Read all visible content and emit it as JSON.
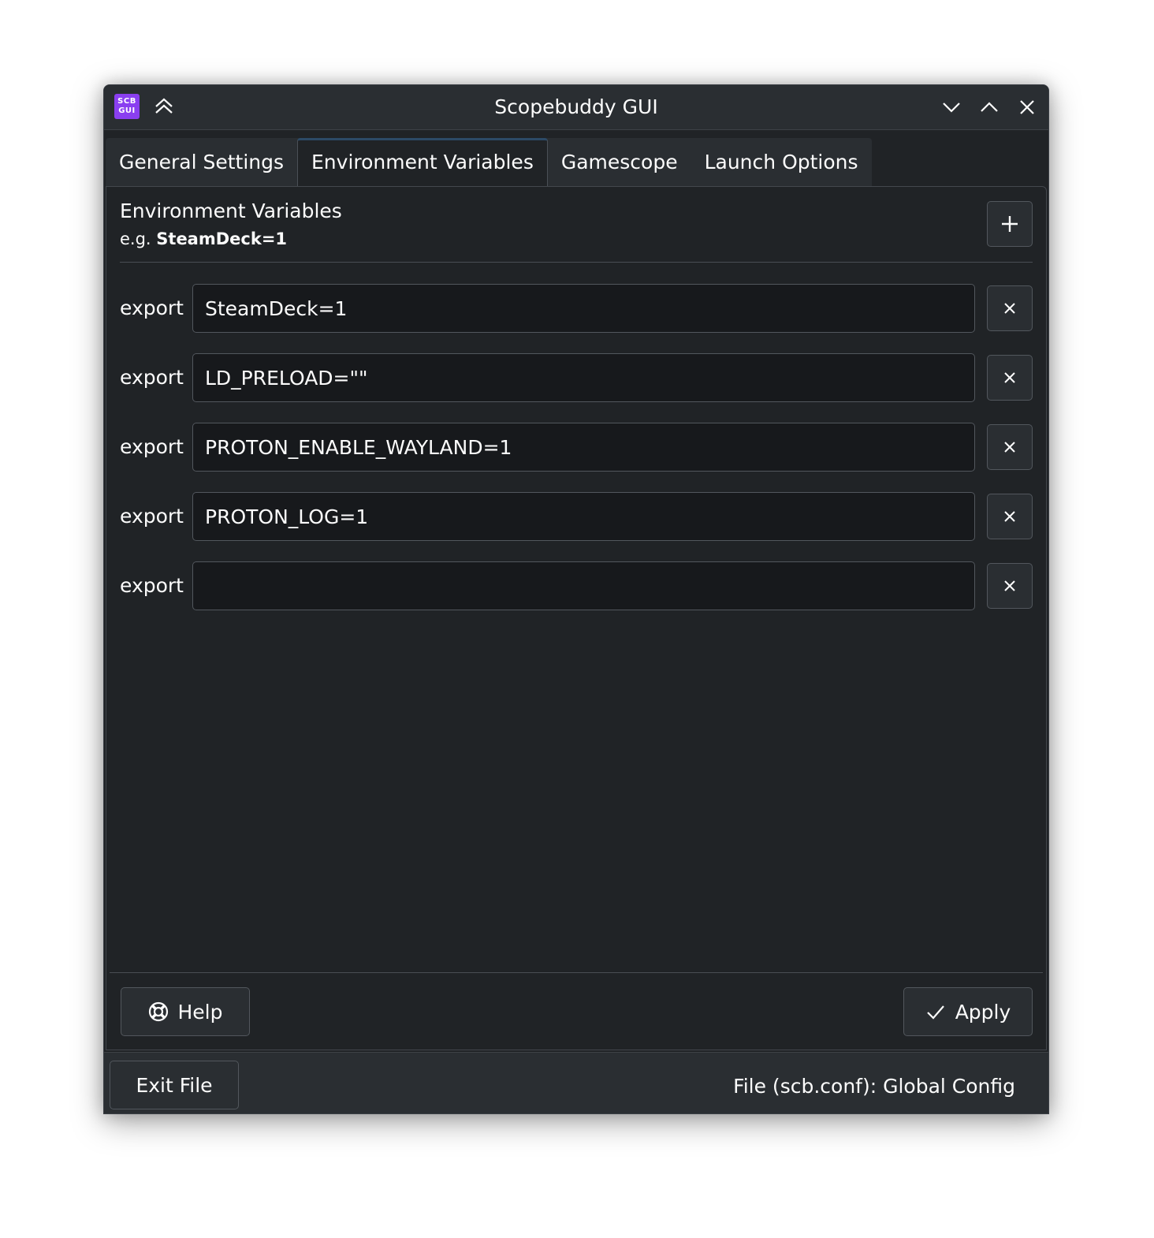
{
  "window": {
    "title": "Scopebuddy GUI",
    "app_icon_line1": "SCB",
    "app_icon_line2": "GUI"
  },
  "tabs": [
    {
      "label": "General Settings",
      "active": false
    },
    {
      "label": "Environment Variables",
      "active": true
    },
    {
      "label": "Gamescope",
      "active": false
    },
    {
      "label": "Launch Options",
      "active": false
    }
  ],
  "env_section": {
    "title": "Environment Variables",
    "hint_prefix": "e.g. ",
    "hint_example": "SteamDeck=1"
  },
  "env_rows": [
    {
      "label": "export",
      "value": "SteamDeck=1"
    },
    {
      "label": "export",
      "value": "LD_PRELOAD=\"\""
    },
    {
      "label": "export",
      "value": "PROTON_ENABLE_WAYLAND=1"
    },
    {
      "label": "export",
      "value": "PROTON_LOG=1"
    },
    {
      "label": "export",
      "value": ""
    }
  ],
  "buttons": {
    "help": "Help",
    "apply": "Apply",
    "exit_file": "Exit File"
  },
  "status": {
    "file_label": "File (scb.conf): Global Config"
  },
  "icons": {
    "add": "plus-icon",
    "remove": "close-icon",
    "help": "lifebuoy-icon",
    "apply": "checkmark-icon",
    "keep_above": "double-chevron-up-icon",
    "minimize": "chevron-down-icon",
    "maximize": "chevron-up-icon",
    "close": "close-icon"
  },
  "colors": {
    "app_icon": "#8a3ff0",
    "window_bg": "#202326",
    "titlebar_bg": "#2a2e32",
    "input_bg": "#17191c",
    "text": "#fcfcfc"
  }
}
